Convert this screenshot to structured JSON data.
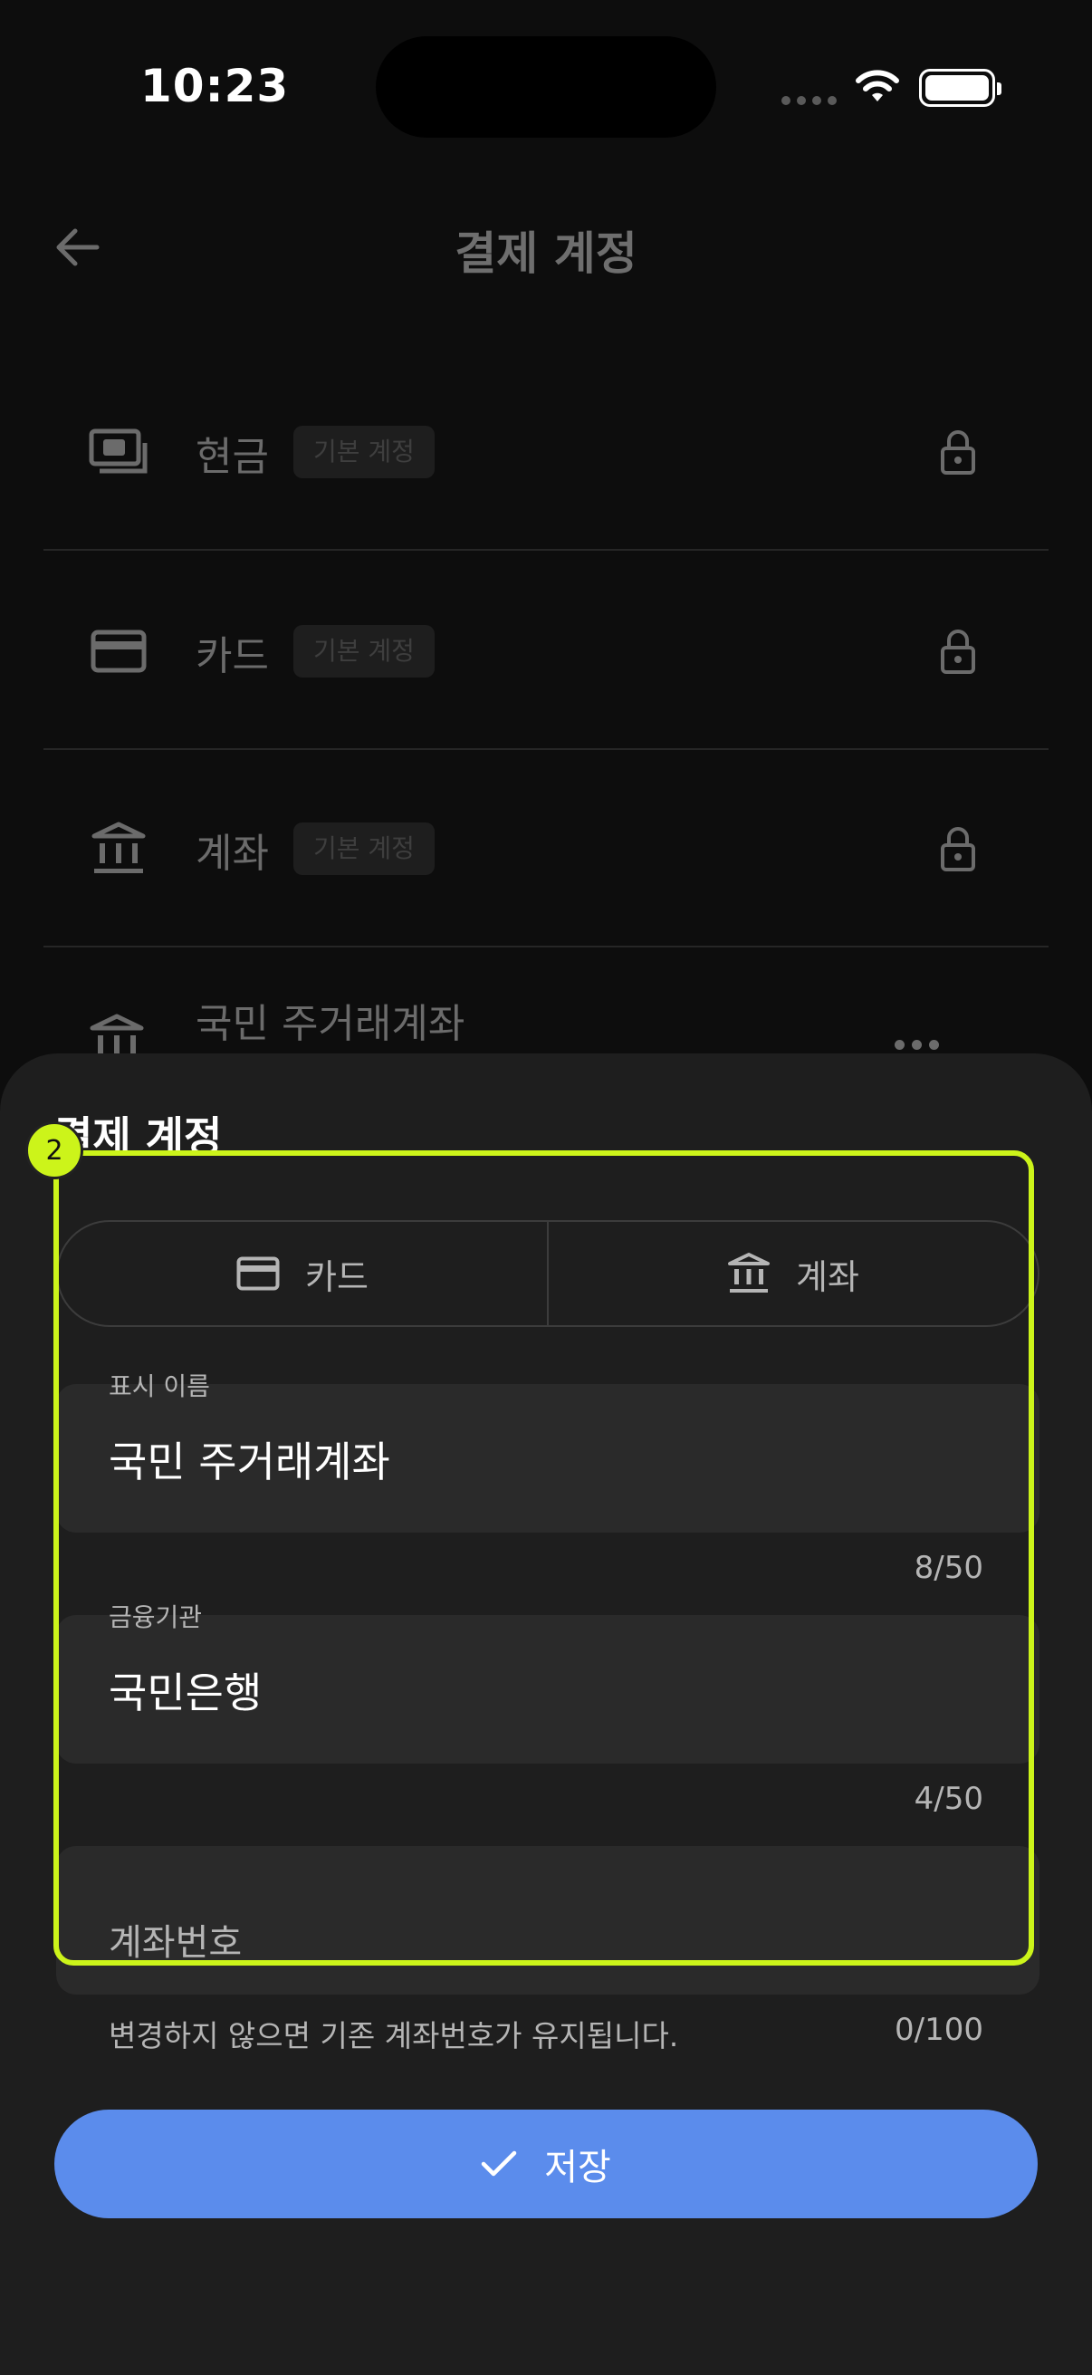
{
  "status_bar": {
    "time": "10:23"
  },
  "header": {
    "title": "결제 계정"
  },
  "accounts": [
    {
      "label": "현금",
      "badge": "기본 계정",
      "icon": "cash-icon"
    },
    {
      "label": "카드",
      "badge": "기본 계정",
      "icon": "card-icon"
    },
    {
      "label": "계좌",
      "badge": "기본 계정",
      "icon": "bank-icon"
    }
  ],
  "custom_account": {
    "label": "국민 주거래계좌",
    "icon": "bank-icon"
  },
  "sheet": {
    "title": "결제 계정",
    "segments": [
      {
        "label": "카드",
        "icon": "card-icon"
      },
      {
        "label": "계좌",
        "icon": "bank-icon"
      }
    ],
    "display_name": {
      "label": "표시 이름",
      "value": "국민 주거래계좌",
      "counter": "8/50"
    },
    "institution": {
      "label": "금융기관",
      "value": "국민은행",
      "counter": "4/50"
    },
    "account_number": {
      "placeholder": "계좌번호",
      "helper": "변경하지 않으면 기존 계좌번호가 유지됩니다.",
      "counter": "0/100"
    },
    "save_label": "저장"
  },
  "annotation": {
    "marker": "2",
    "color": "#ccf41a"
  },
  "colors": {
    "accent": "#5b8cec",
    "sheet_bg": "#1e1e1e",
    "field_bg": "#2a2a2a"
  }
}
